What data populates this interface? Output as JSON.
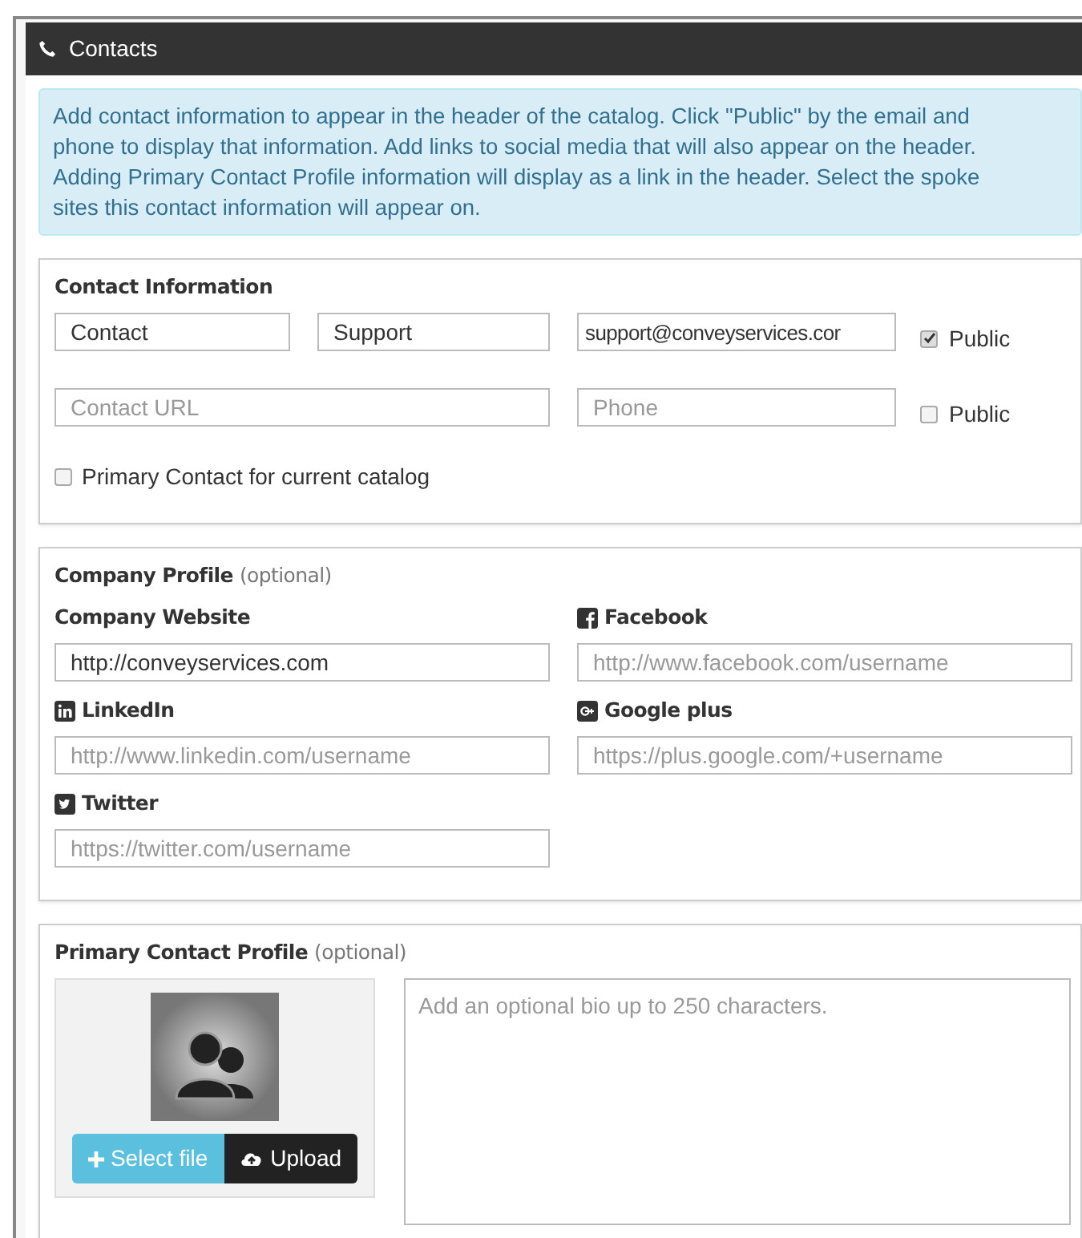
{
  "panel": {
    "title": "Contacts"
  },
  "info": "Add contact information to appear in the header of the catalog. Click \"Public\" by the email and phone to display that information. Add links to social media that will also appear on the header. Adding Primary Contact Profile information will display as a link in the header. Select the spoke sites this contact information will appear on.",
  "contact_information": {
    "title": "Contact Information",
    "first_name": {
      "value": "Contact"
    },
    "last_name": {
      "value": "Support"
    },
    "email": {
      "value": "support@conveyservices.cor",
      "public_label": "Public",
      "public_checked": true
    },
    "url": {
      "placeholder": "Contact URL"
    },
    "phone": {
      "placeholder": "Phone",
      "public_label": "Public",
      "public_checked": false
    },
    "primary": {
      "label": "Primary Contact for current catalog",
      "checked": false
    }
  },
  "company_profile": {
    "title": "Company Profile",
    "note": "(optional)",
    "fields": [
      {
        "kind": "website",
        "label": "Company Website",
        "value": "http://conveyservices.com"
      },
      {
        "kind": "facebook",
        "label": "Facebook",
        "placeholder": "http://www.facebook.com/username"
      },
      {
        "kind": "linkedin",
        "label": "LinkedIn",
        "placeholder": "http://www.linkedin.com/username"
      },
      {
        "kind": "googleplus",
        "label": "Google plus",
        "placeholder": "https://plus.google.com/+username"
      },
      {
        "kind": "twitter",
        "label": "Twitter",
        "placeholder": "https://twitter.com/username"
      }
    ]
  },
  "primary_contact_profile": {
    "title": "Primary Contact Profile",
    "note": "(optional)",
    "select_button": "Select file",
    "upload_button": "Upload",
    "bio": {
      "placeholder": "Add an optional bio up to 250 characters."
    }
  }
}
